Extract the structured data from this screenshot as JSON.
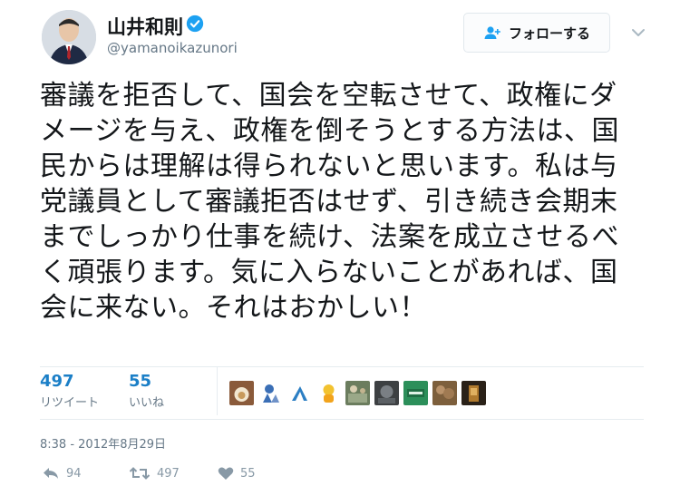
{
  "author": {
    "display_name": "山井和則",
    "handle": "@yamanoikazunori",
    "verified": true,
    "avatar_icon": "person-avatar-icon"
  },
  "follow_button": {
    "label": "フォローする",
    "icon": "add-user-icon"
  },
  "menu": {
    "icon": "chevron-down-icon"
  },
  "tweet": {
    "text": "審議を拒否して、国会を空転させて、政権にダメージを与え、政権を倒そうとする方法は、国民からは理解は得られないと思います。私は与党議員として審議拒否はせず、引き続き会期末までしっかり仕事を続け、法案を成立させるべく頑張ります。気に入らないことがあれば、国会に来ない。それはおかしい！"
  },
  "stats": {
    "retweets_count": "497",
    "retweets_label": "リツイート",
    "likes_count": "55",
    "likes_label": "いいね"
  },
  "likers": [
    "liker-avatar-1",
    "liker-avatar-2",
    "liker-avatar-3",
    "liker-avatar-4",
    "liker-avatar-5",
    "liker-avatar-6",
    "liker-avatar-7",
    "liker-avatar-8",
    "liker-avatar-9"
  ],
  "timestamp": "8:38 - 2012年8月29日",
  "actions": {
    "reply_count": "94",
    "retweet_count": "497",
    "like_count": "55"
  },
  "colors": {
    "link_blue": "#1b7fc7",
    "verified_blue": "#1da1f2",
    "muted_gray": "#8899a6"
  }
}
